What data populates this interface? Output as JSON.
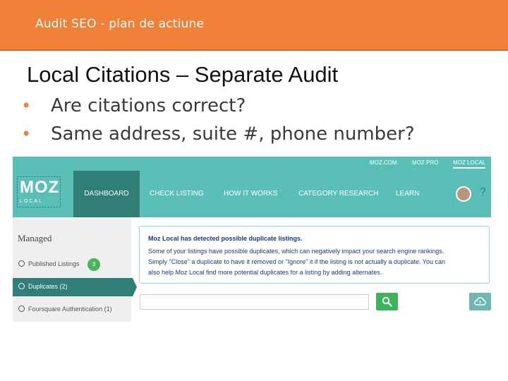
{
  "header": {
    "title": "Audit SEO - plan de actiune"
  },
  "slide": {
    "title": "Local Citations – Separate Audit",
    "bullets": [
      "Are citations correct?",
      "Same address, suite #, phone number?"
    ]
  },
  "app": {
    "toplinks": [
      "MOZ.COM",
      "MOZ PRO",
      "MOZ LOCAL"
    ],
    "logo": {
      "main": "MOZ",
      "sub": "LOCAL"
    },
    "nav": [
      "DASHBOARD",
      "CHECK LISTING",
      "HOW IT WORKS",
      "CATEGORY RESEARCH",
      "LEARN"
    ],
    "help_label": "?",
    "sidebar": {
      "heading": "Managed",
      "items": [
        {
          "label": "Published Listings",
          "badge": "3"
        },
        {
          "label": "Duplicates (2)"
        },
        {
          "label": "Foursquare Authentication (1)"
        }
      ]
    },
    "alert": {
      "title": "Moz Local has detected possible duplicate listings.",
      "lines": [
        "Some of your listings have possible duplicates, which can negatively impact your search engine rankings.",
        "Simply \"Close\" a duplicate to have it removed or \"Ignore\" it if the listing is not actually a duplicate. You can",
        "also help Moz Local find more potential duplicates for a listing by adding alternates."
      ]
    },
    "search": {
      "placeholder": ""
    },
    "colors": {
      "accent": "#f07f37",
      "teal": "#5ac0b7",
      "teal_dark": "#2f7e77",
      "green": "#3bb559"
    }
  }
}
